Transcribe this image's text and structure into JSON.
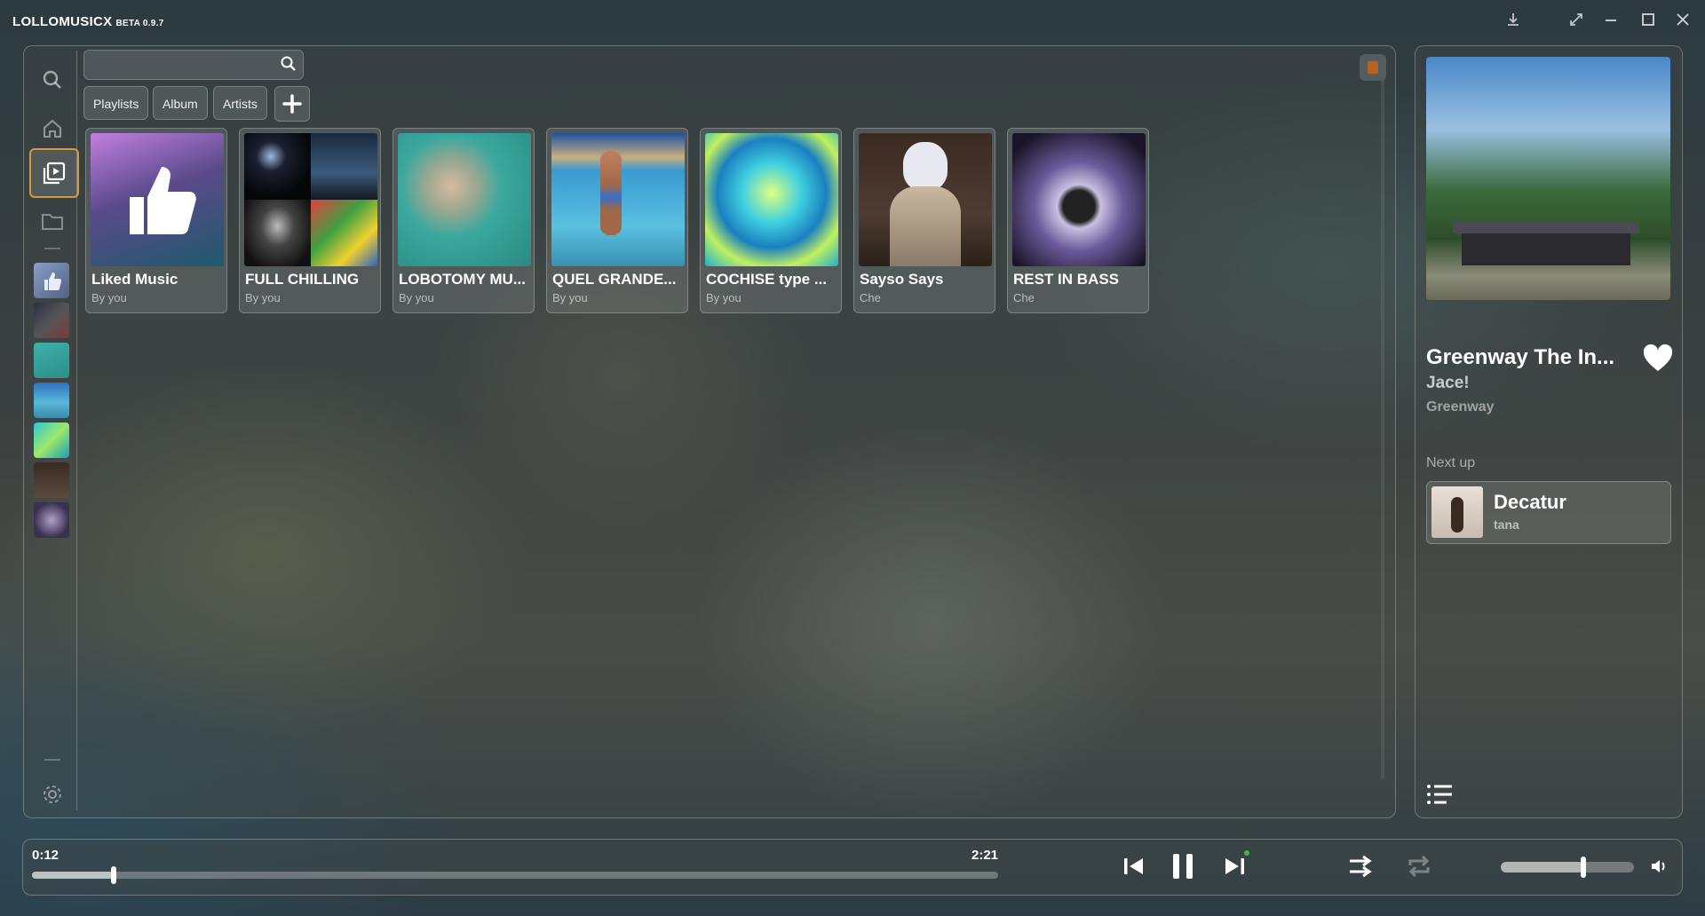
{
  "app": {
    "title": "LOLLOMUSICX",
    "version": "BETA 0.9.7"
  },
  "window_controls": [
    "download-icon",
    "expand-icon",
    "minimize-icon",
    "maximize-icon",
    "close-icon"
  ],
  "search": {
    "placeholder": "",
    "value": ""
  },
  "filters": [
    {
      "label": "Playlists"
    },
    {
      "label": "Album"
    },
    {
      "label": "Artists"
    }
  ],
  "sidebar": {
    "items": [
      "search-icon",
      "home-icon",
      "library-icon",
      "folder-icon"
    ],
    "active": "library-icon",
    "settings": "gear-icon"
  },
  "library": [
    {
      "title": "Liked Music",
      "subtitle": "By you"
    },
    {
      "title": "FULL CHILLING",
      "subtitle": "By you"
    },
    {
      "title": "LOBOTOMY MU...",
      "subtitle": "By you"
    },
    {
      "title": "QUEL GRANDE...",
      "subtitle": "By you"
    },
    {
      "title": "COCHISE type ...",
      "subtitle": "By you"
    },
    {
      "title": "Sayso Says",
      "subtitle": "Che"
    },
    {
      "title": "REST IN BASS",
      "subtitle": "Che"
    }
  ],
  "now_playing": {
    "title": "Greenway The In...",
    "artist": "Jace!",
    "album": "Greenway",
    "liked": true
  },
  "next_up": {
    "label": "Next up",
    "title": "Decatur",
    "artist": "tana"
  },
  "player": {
    "elapsed": "0:12",
    "duration": "2:21",
    "progress_fraction": 0.085,
    "volume_fraction": 0.62,
    "state": "playing"
  },
  "colors": {
    "accent": "#d49a3c",
    "notification": "#b8621f",
    "online_dot": "#4caf50"
  }
}
